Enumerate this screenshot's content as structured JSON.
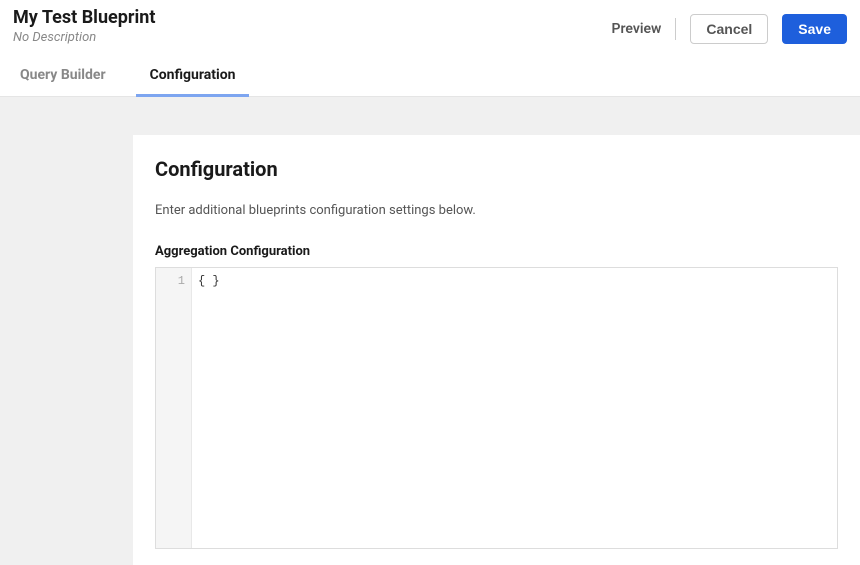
{
  "header": {
    "title": "My Test Blueprint",
    "subtitle": "No Description",
    "preview": "Preview",
    "cancel": "Cancel",
    "save": "Save"
  },
  "tabs": {
    "query_builder": "Query Builder",
    "configuration": "Configuration"
  },
  "panel": {
    "title": "Configuration",
    "description": "Enter additional blueprints configuration settings below.",
    "section_label": "Aggregation Configuration"
  },
  "editor": {
    "line_number": "1",
    "content": "{ }"
  }
}
